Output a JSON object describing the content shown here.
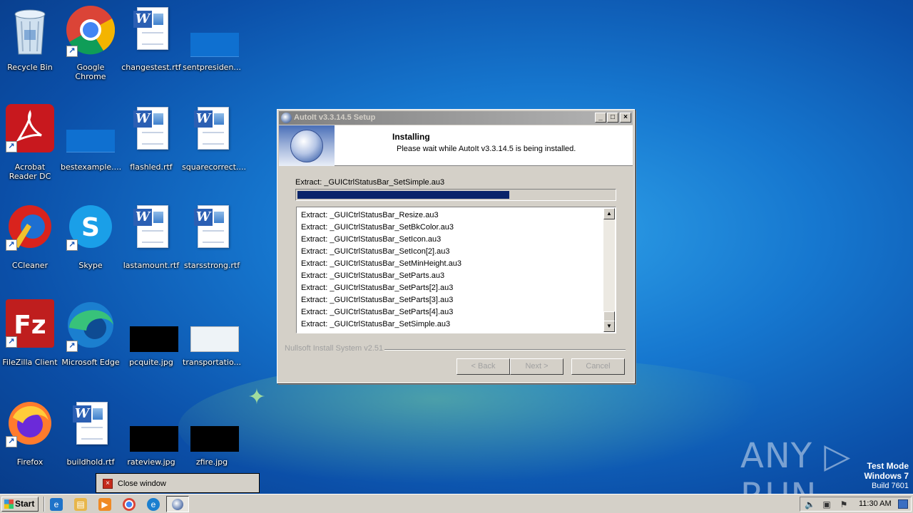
{
  "desktop": {
    "icons": [
      {
        "label": "Recycle Bin",
        "icon": "recycle-bin-icon"
      },
      {
        "label": "Google Chrome",
        "icon": "chrome-icon"
      },
      {
        "label": "changestest.rtf",
        "icon": "word-document-icon"
      },
      {
        "label": "sentpresiden...",
        "icon": "image-file-icon"
      },
      {
        "label": "Acrobat Reader DC",
        "icon": "acrobat-icon"
      },
      {
        "label": "bestexample....",
        "icon": "image-file-icon"
      },
      {
        "label": "flashled.rtf",
        "icon": "word-document-icon"
      },
      {
        "label": "squarecorrect....",
        "icon": "word-document-icon"
      },
      {
        "label": "CCleaner",
        "icon": "ccleaner-icon"
      },
      {
        "label": "Skype",
        "icon": "skype-icon"
      },
      {
        "label": "lastamount.rtf",
        "icon": "word-document-icon"
      },
      {
        "label": "starsstrong.rtf",
        "icon": "word-document-icon"
      },
      {
        "label": "FileZilla Client",
        "icon": "filezilla-icon"
      },
      {
        "label": "Microsoft Edge",
        "icon": "edge-icon"
      },
      {
        "label": "pcquite.jpg",
        "icon": "image-file-icon"
      },
      {
        "label": "transportatio...",
        "icon": "image-file-icon"
      },
      {
        "label": "Firefox",
        "icon": "firefox-icon"
      },
      {
        "label": "buildhold.rtf",
        "icon": "word-document-icon"
      },
      {
        "label": "rateview.jpg",
        "icon": "image-file-icon"
      },
      {
        "label": "zfire.jpg",
        "icon": "image-file-icon"
      }
    ]
  },
  "dialog": {
    "title": "AutoIt v3.3.14.5 Setup",
    "header_title": "Installing",
    "header_subtitle": "Please wait while AutoIt v3.3.14.5 is being installed.",
    "current_action": "Extract: _GUICtrlStatusBar_SetSimple.au3",
    "progress_fraction": 0.67,
    "log_lines": [
      "Extract: _GUICtrlStatusBar_Resize.au3",
      "Extract: _GUICtrlStatusBar_SetBkColor.au3",
      "Extract: _GUICtrlStatusBar_SetIcon.au3",
      "Extract: _GUICtrlStatusBar_SetIcon[2].au3",
      "Extract: _GUICtrlStatusBar_SetMinHeight.au3",
      "Extract: _GUICtrlStatusBar_SetParts.au3",
      "Extract: _GUICtrlStatusBar_SetParts[2].au3",
      "Extract: _GUICtrlStatusBar_SetParts[3].au3",
      "Extract: _GUICtrlStatusBar_SetParts[4].au3",
      "Extract: _GUICtrlStatusBar_SetSimple.au3"
    ],
    "branding": "Nullsoft Install System v2.51",
    "buttons": {
      "back": "< Back",
      "next": "Next >",
      "cancel": "Cancel"
    },
    "window_buttons": {
      "minimize": "_",
      "maximize": "□",
      "close": "×"
    }
  },
  "tooltip": {
    "text": "Close window",
    "icon": "close-window-icon"
  },
  "watermark": {
    "text": "ANY ▷ RUN"
  },
  "test_mode": {
    "line1": "Test Mode",
    "line2": "Windows 7",
    "line3": "Build 7601"
  },
  "taskbar": {
    "start_label": "Start",
    "quick_launch": [
      "ie-icon",
      "explorer-icon",
      "media-player-icon",
      "chrome-icon",
      "edge-icon"
    ],
    "active_task_icon": "autoit-setup-icon",
    "clock": "11:30 AM"
  },
  "colors": {
    "progress": "#0a246a",
    "desktop": "#1677cf",
    "dialog_face": "#d4d0c8"
  }
}
